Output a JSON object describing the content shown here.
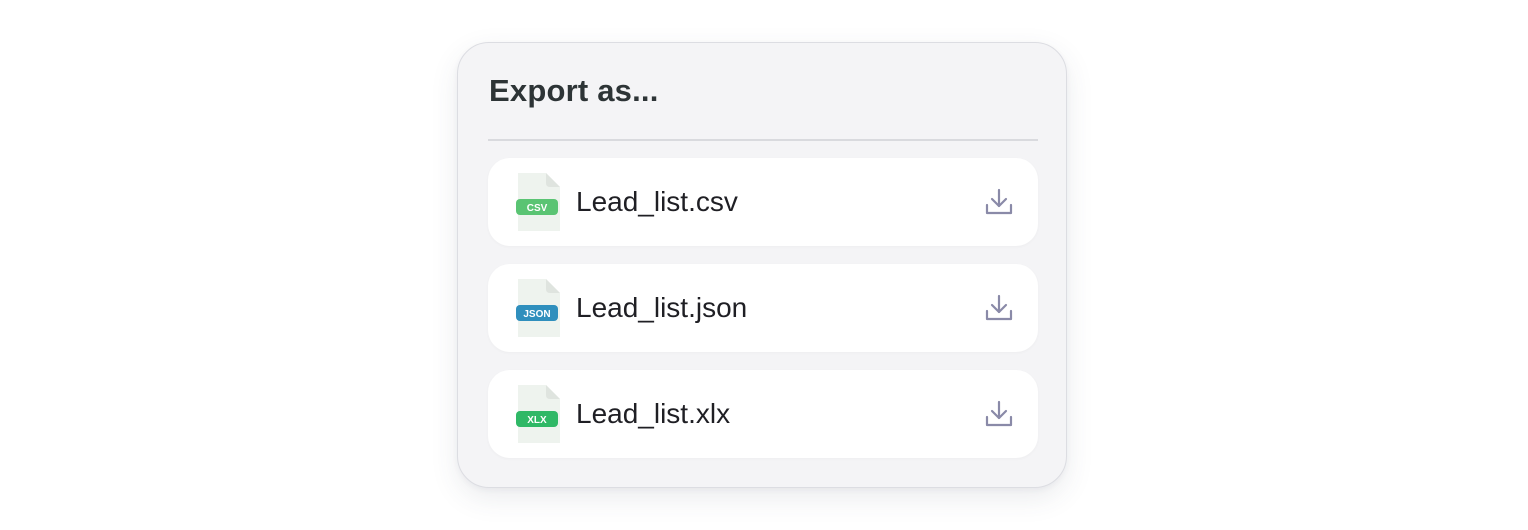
{
  "dialog": {
    "title": "Export as..."
  },
  "files": [
    {
      "name": "Lead_list.csv",
      "badge": "CSV",
      "badge_color": "#5ac473"
    },
    {
      "name": "Lead_list.json",
      "badge": "JSON",
      "badge_color": "#2f8fbd"
    },
    {
      "name": "Lead_list.xlx",
      "badge": "XLX",
      "badge_color": "#2fb866"
    }
  ],
  "icons": {
    "file": "file-icon",
    "download": "download-icon"
  },
  "colors": {
    "title": "#2d3436",
    "download_icon": "#8a8aa8",
    "file_page": "#eef2ee"
  }
}
